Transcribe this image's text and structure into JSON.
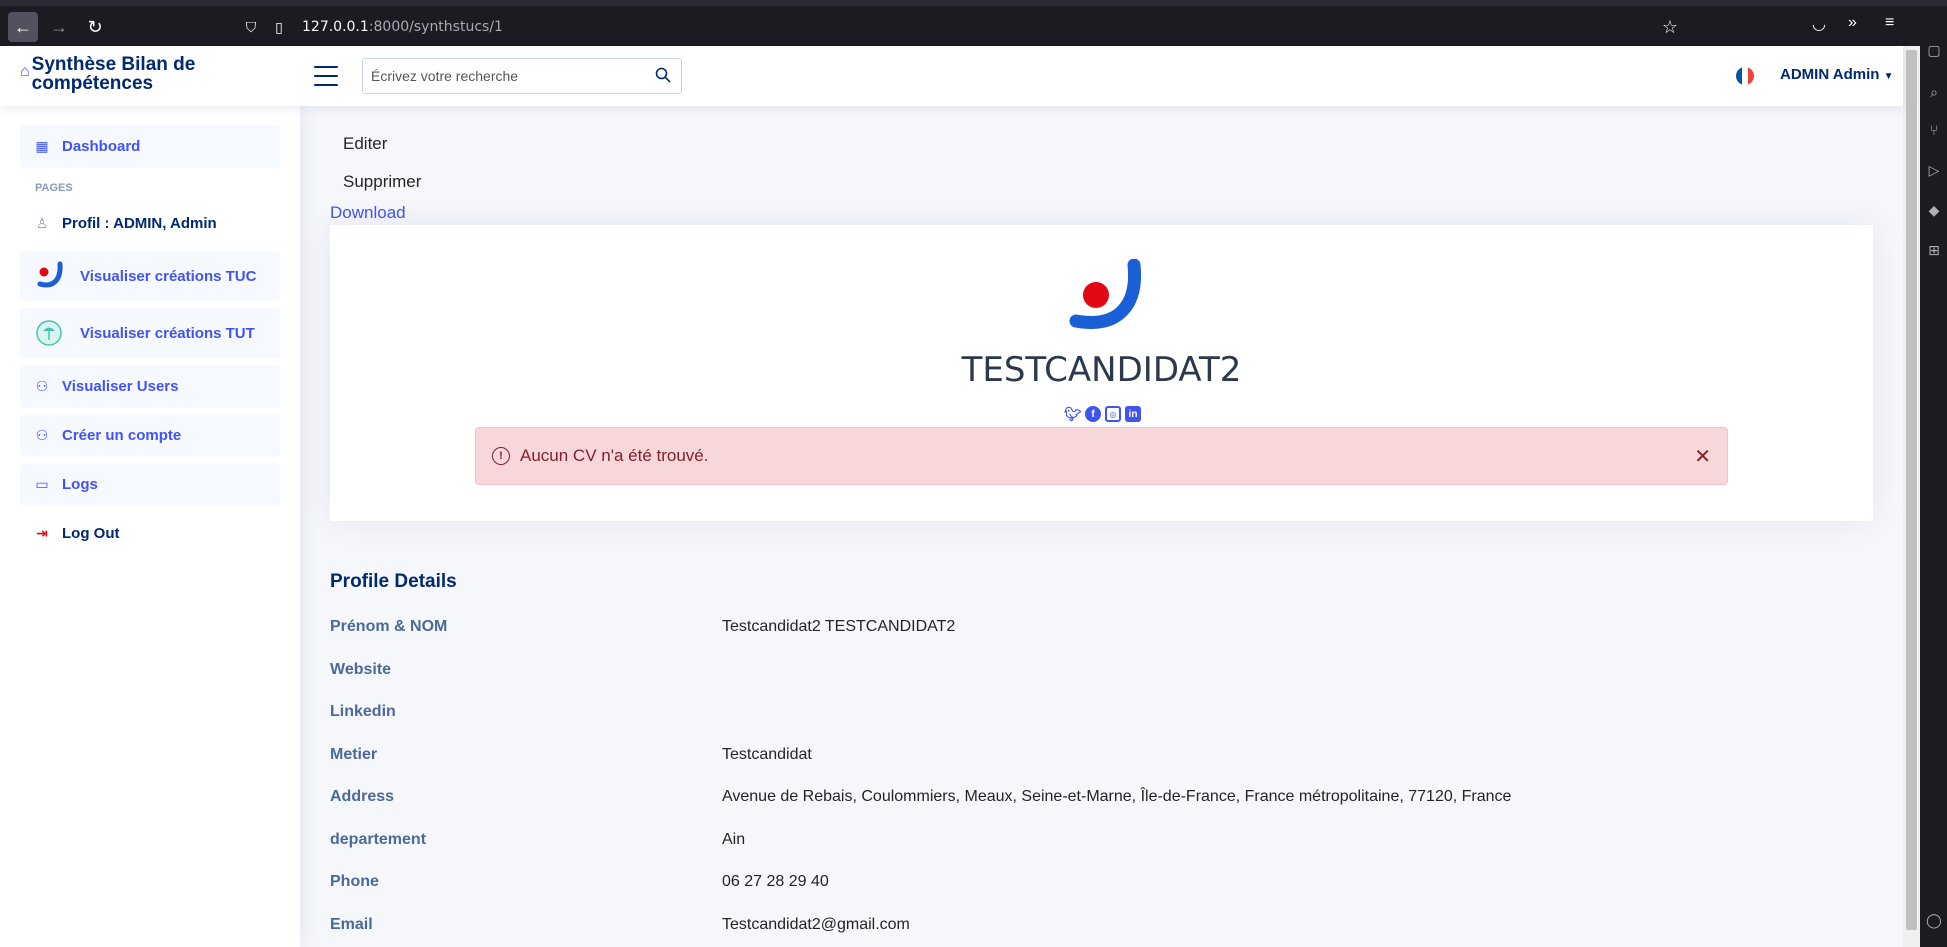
{
  "browser": {
    "url_host": "127.0.0.1",
    "url_rest": ":8000/synthstucs/1"
  },
  "header": {
    "logo_text": "Synthèse Bilan de compétences",
    "search_placeholder": "Écrivez votre recherche",
    "user_label": "ADMIN Admin"
  },
  "sidebar": {
    "dashboard": "Dashboard",
    "pages_heading": "PAGES",
    "profil": "Profil : ADMIN, Admin",
    "tuc": "Visualiser créations TUC",
    "tut": "Visualiser créations TUT",
    "users": "Visualiser Users",
    "create_account": "Créer un compte",
    "logs": "Logs",
    "logout": "Log Out"
  },
  "actions": {
    "edit": "Editer",
    "delete": "Supprimer",
    "download": "Download"
  },
  "card": {
    "name": "TESTCANDIDAT2",
    "alert": "Aucun CV n'a été trouvé."
  },
  "profile": {
    "title": "Profile Details",
    "rows": [
      {
        "label": "Prénom & NOM",
        "value": "Testcandidat2 TESTCANDIDAT2"
      },
      {
        "label": "Website",
        "value": ""
      },
      {
        "label": "Linkedin",
        "value": ""
      },
      {
        "label": "Metier",
        "value": "Testcandidat"
      },
      {
        "label": "Address",
        "value": "Avenue de Rebais, Coulommiers, Meaux, Seine-et-Marne, Île-de-France, France métropolitaine, 77120, France"
      },
      {
        "label": "departement",
        "value": "Ain"
      },
      {
        "label": "Phone",
        "value": "06 27 28 29 40"
      },
      {
        "label": "Email",
        "value": "Testcandidat2@gmail.com"
      }
    ]
  },
  "colors": {
    "accent": "#4154f1",
    "navy": "#012970",
    "alert_bg": "#f8d7da",
    "alert_text": "#842029"
  }
}
